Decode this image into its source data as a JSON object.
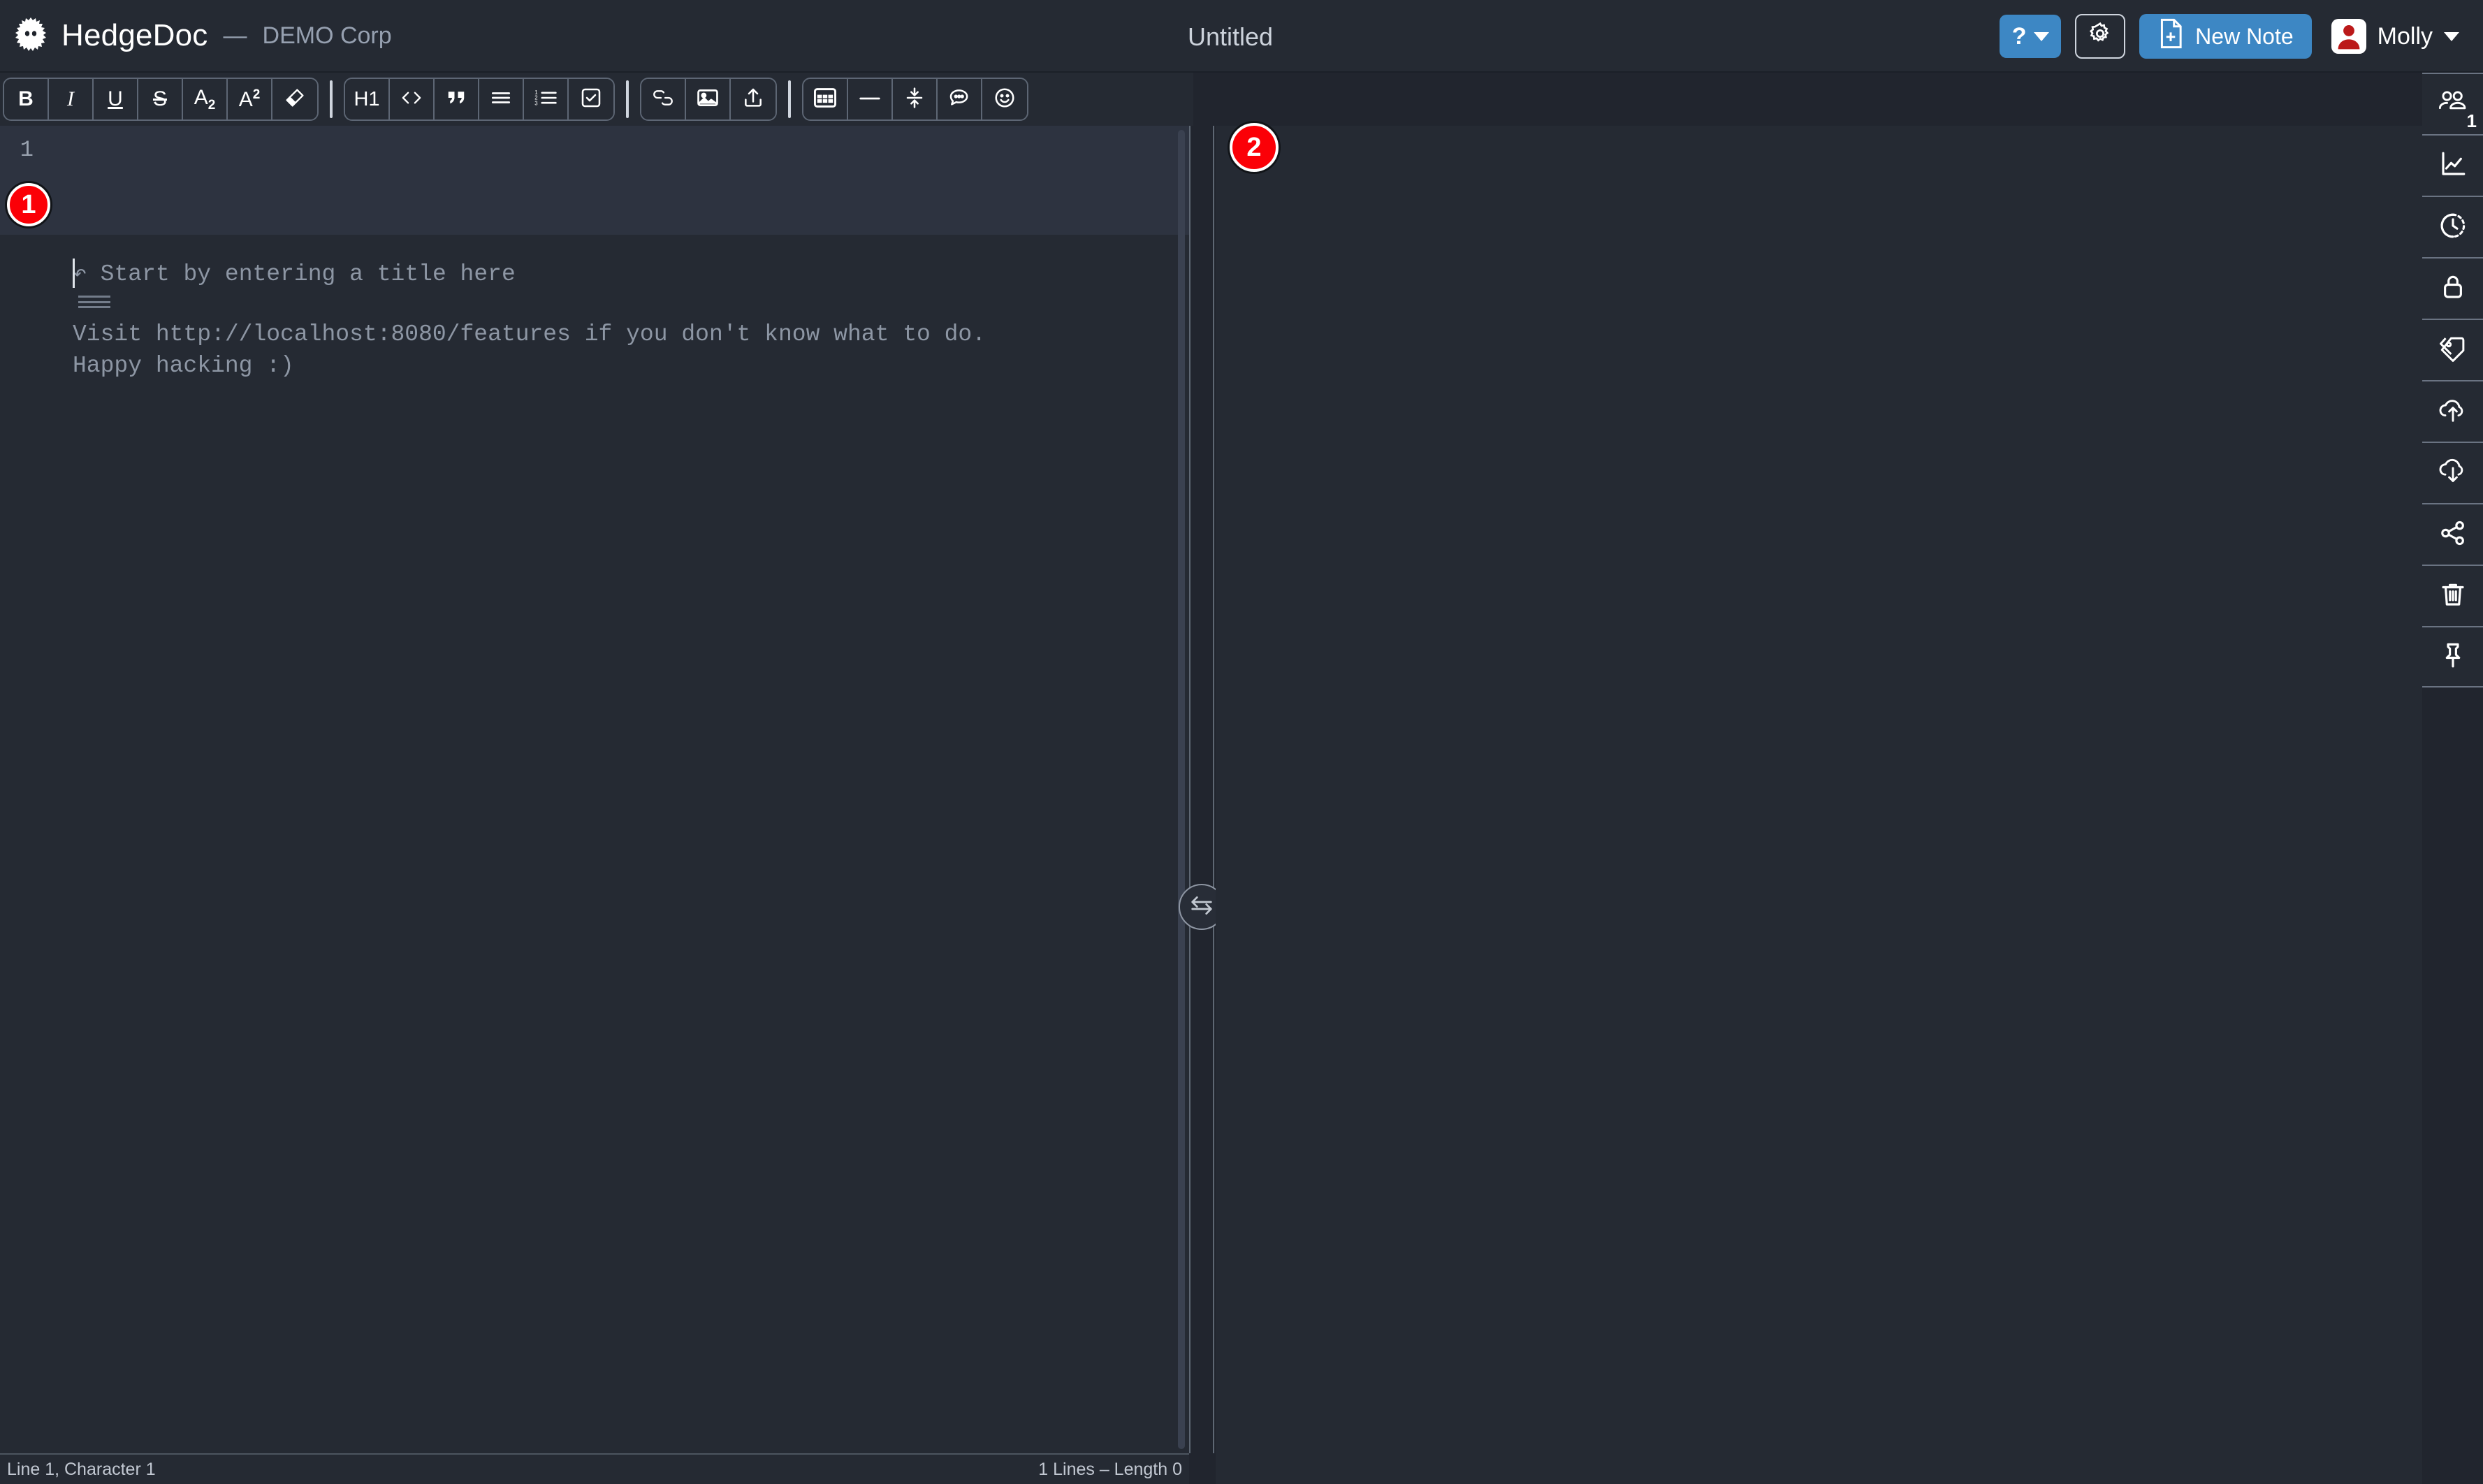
{
  "app": {
    "brand_name": "HedgeDoc",
    "brand_dash": "—",
    "brand_org": "DEMO Corp",
    "logo_icon": "hedgehog-logo-icon"
  },
  "header": {
    "doc_title": "Untitled",
    "help_label": "?",
    "help_icon": "question-mark-icon",
    "settings_icon": "gear-icon",
    "new_note_label": "New Note",
    "new_note_icon": "file-plus-icon",
    "user_name": "Molly",
    "user_avatar_icon": "user-avatar-icon",
    "accent_color": "#3d87c4",
    "header_bg": "#252a33"
  },
  "toolbar": {
    "groups": [
      {
        "name": "text-format",
        "items": [
          {
            "name": "bold-button",
            "label": "B",
            "icon": "bold-icon"
          },
          {
            "name": "italic-button",
            "label": "I",
            "icon": "italic-icon"
          },
          {
            "name": "underline-button",
            "label": "U",
            "icon": "underline-icon"
          },
          {
            "name": "strikethrough-button",
            "label": "S",
            "icon": "strikethrough-icon"
          },
          {
            "name": "subscript-button",
            "label": "A",
            "sub": "2",
            "icon": "subscript-icon"
          },
          {
            "name": "superscript-button",
            "label": "A",
            "sup": "2",
            "icon": "superscript-icon"
          },
          {
            "name": "highlight-button",
            "label": "",
            "icon": "highlighter-icon"
          }
        ]
      },
      {
        "name": "block-format",
        "items": [
          {
            "name": "heading-button",
            "label": "H1",
            "icon": "heading-icon"
          },
          {
            "name": "code-block-button",
            "label": "",
            "icon": "code-icon"
          },
          {
            "name": "blockquote-button",
            "label": "",
            "icon": "quote-icon"
          },
          {
            "name": "unordered-list-button",
            "label": "",
            "icon": "bullet-list-icon"
          },
          {
            "name": "ordered-list-button",
            "label": "",
            "icon": "numbered-list-icon"
          },
          {
            "name": "check-list-button",
            "label": "",
            "icon": "check-list-icon"
          }
        ]
      },
      {
        "name": "insert-media",
        "items": [
          {
            "name": "link-button",
            "label": "",
            "icon": "link-icon"
          },
          {
            "name": "image-button",
            "label": "",
            "icon": "image-icon"
          },
          {
            "name": "upload-button",
            "label": "",
            "icon": "upload-icon"
          }
        ]
      },
      {
        "name": "insert-block",
        "items": [
          {
            "name": "table-button",
            "label": "",
            "icon": "table-icon"
          },
          {
            "name": "horizontal-rule-button",
            "label": "",
            "icon": "horizontal-rule-icon"
          },
          {
            "name": "collapsible-block-button",
            "label": "",
            "icon": "collapse-icon"
          },
          {
            "name": "comment-button",
            "label": "",
            "icon": "comment-icon"
          },
          {
            "name": "emoji-button",
            "label": "",
            "icon": "emoji-icon"
          }
        ]
      }
    ]
  },
  "editor": {
    "line_number": "1",
    "placeholder_title": "↶ Start by entering a title here",
    "placeholder_visit": "Visit http://localhost:8080/features if you don't know what to do.",
    "placeholder_happy": "Happy hacking :)",
    "drag_handle_icon": "drag-handle-icon",
    "active_line_bg": "#2d3340",
    "editor_bg": "#252a33"
  },
  "splitter": {
    "toggle_icon": "swap-arrows-icon"
  },
  "sidebar": {
    "items": [
      {
        "name": "sidebar-item-online-users",
        "icon": "users-icon",
        "badge": "1"
      },
      {
        "name": "sidebar-item-slide-mode",
        "icon": "chart-line-icon",
        "badge": ""
      },
      {
        "name": "sidebar-item-revisions",
        "icon": "history-clock-icon",
        "badge": ""
      },
      {
        "name": "sidebar-item-permissions",
        "icon": "lock-icon",
        "badge": ""
      },
      {
        "name": "sidebar-item-tags",
        "icon": "tag-icon",
        "badge": ""
      },
      {
        "name": "sidebar-item-import",
        "icon": "cloud-upload-icon",
        "badge": ""
      },
      {
        "name": "sidebar-item-export",
        "icon": "cloud-download-icon",
        "badge": ""
      },
      {
        "name": "sidebar-item-share",
        "icon": "share-icon",
        "badge": ""
      },
      {
        "name": "sidebar-item-delete",
        "icon": "trash-icon",
        "badge": ""
      },
      {
        "name": "sidebar-item-pin",
        "icon": "pin-icon",
        "badge": ""
      }
    ]
  },
  "status_bar": {
    "cursor_position": "Line 1, Character 1",
    "document_stats": "1 Lines – Length 0"
  },
  "annotations": [
    {
      "name": "annotation-badge-1",
      "label": "1",
      "color": "#fb0007"
    },
    {
      "name": "annotation-badge-2",
      "label": "2",
      "color": "#fb0007"
    }
  ]
}
